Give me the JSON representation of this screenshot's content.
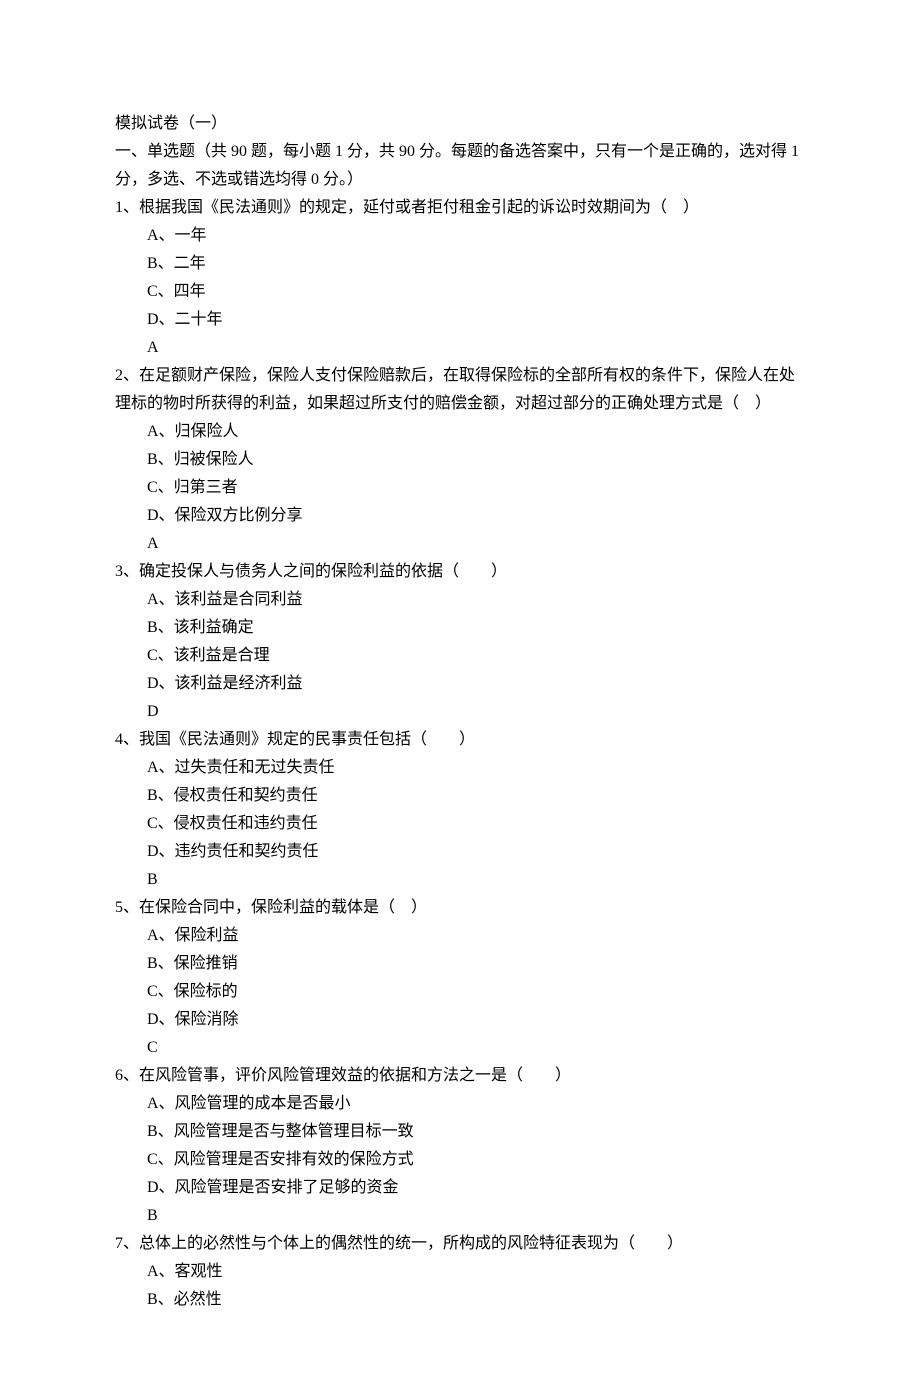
{
  "title": "模拟试卷（一）",
  "section_intro": "一、单选题（共 90 题，每小题 1 分，共 90 分。每题的备选答案中，只有一个是正确的，选对得 1 分，多选、不选或错选均得 0 分。）",
  "questions": [
    {
      "stem": "1、根据我国《民法通则》的规定，延付或者拒付租金引起的诉讼时效期间为（　）",
      "options": [
        "A、一年",
        "B、二年",
        "C、四年",
        "D、二十年"
      ],
      "answer": "A"
    },
    {
      "stem": "2、在足额财产保险，保险人支付保险赔款后，在取得保险标的全部所有权的条件下，保险人在处理标的物时所获得的利益，如果超过所支付的赔偿金额，对超过部分的正确处理方式是（　）",
      "options": [
        "A、归保险人",
        "B、归被保险人",
        "C、归第三者",
        "D、保险双方比例分享"
      ],
      "answer": "A"
    },
    {
      "stem": "3、确定投保人与债务人之间的保险利益的依据（　　）",
      "options": [
        "A、该利益是合同利益",
        "B、该利益确定",
        "C、该利益是合理",
        "D、该利益是经济利益"
      ],
      "answer": "D"
    },
    {
      "stem": "4、我国《民法通则》规定的民事责任包括（　　）",
      "options": [
        "A、过失责任和无过失责任",
        "B、侵权责任和契约责任",
        "C、侵权责任和违约责任",
        "D、违约责任和契约责任"
      ],
      "answer": "B"
    },
    {
      "stem": "5、在保险合同中，保险利益的载体是（　）",
      "options": [
        "A、保险利益",
        "B、保险推销",
        "C、保险标的",
        "D、保险消除"
      ],
      "answer": "C"
    },
    {
      "stem": "6、在风险管事，评价风险管理效益的依据和方法之一是（　　）",
      "options": [
        "A、风险管理的成本是否最小",
        "B、风险管理是否与整体管理目标一致",
        "C、风险管理是否安排有效的保险方式",
        "D、风险管理是否安排了足够的资金"
      ],
      "answer": "B"
    },
    {
      "stem": "7、总体上的必然性与个体上的偶然性的统一，所构成的风险特征表现为（　　）",
      "options": [
        "A、客观性",
        "B、必然性"
      ],
      "answer": ""
    }
  ]
}
